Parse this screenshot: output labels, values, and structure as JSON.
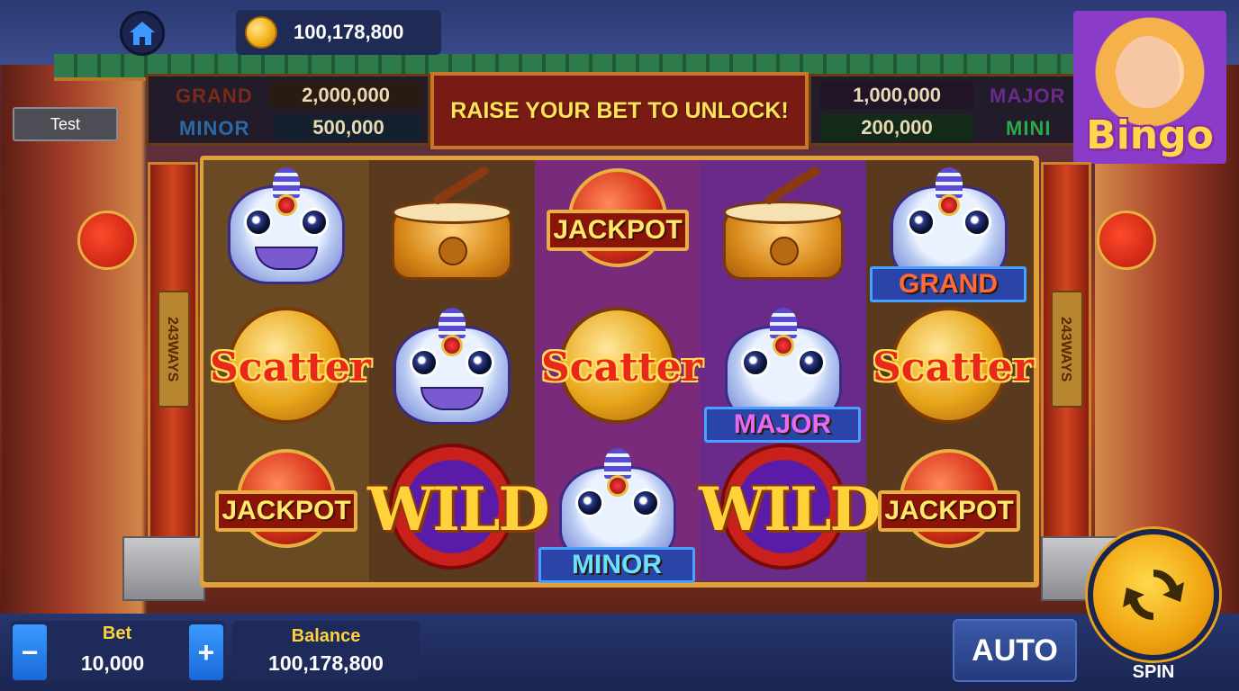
{
  "header": {
    "coin_balance": "100,178,800"
  },
  "test_button": {
    "label": "Test"
  },
  "jackpots": {
    "grand": {
      "label": "GRAND",
      "value": "2,000,000",
      "color": "#7a2a1a"
    },
    "minor": {
      "label": "MINOR",
      "value": "500,000",
      "color": "#2a6aa8"
    },
    "major": {
      "label": "MAJOR",
      "value": "1,000,000",
      "color": "#6a2a8a"
    },
    "mini": {
      "label": "MINI",
      "value": "200,000",
      "color": "#2aa84a"
    }
  },
  "unlock_banner": "RAISE YOUR BET TO UNLOCK!",
  "promo": {
    "text": "Bingo"
  },
  "pillars": {
    "left_label": "243WAYS",
    "right_label": "243WAYS"
  },
  "reels": {
    "row1": [
      "lion",
      "drum",
      "jackpot",
      "drum",
      "lion"
    ],
    "row2": [
      "scatter",
      "lion",
      "scatter",
      "lion",
      "scatter"
    ],
    "row3": [
      "jackpot",
      "wild",
      "lion",
      "wild",
      "jackpot"
    ],
    "labels": {
      "jackpot": "JACKPOT",
      "scatter": "Scatter",
      "wild": "WILD",
      "grand": "GRAND",
      "major": "MAJOR",
      "minor": "MINOR"
    }
  },
  "bottom": {
    "bet_label": "Bet",
    "bet_value": "10,000",
    "minus": "−",
    "plus": "+",
    "balance_label": "Balance",
    "balance_value": "100,178,800",
    "auto_label": "AUTO",
    "spin_label": "SPIN"
  },
  "colors": {
    "accent_gold": "#ffd23a",
    "button_blue": "#2a7ae8",
    "reel_border": "#e0a03a"
  }
}
